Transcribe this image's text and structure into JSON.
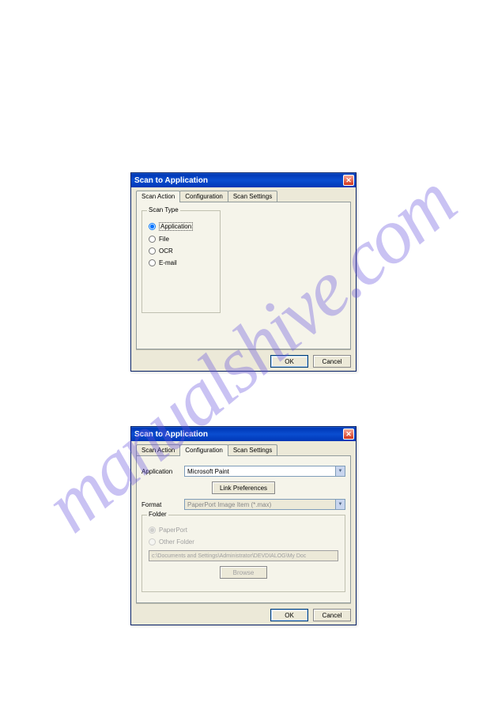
{
  "watermark": "manualshive.com",
  "dialog1": {
    "title": "Scan to Application",
    "tabs": {
      "scan_action": "Scan Action",
      "configuration": "Configuration",
      "scan_settings": "Scan Settings"
    },
    "group": {
      "legend": "Scan Type",
      "options": {
        "application": "Application",
        "file": "File",
        "ocr": "OCR",
        "email": "E-mail"
      }
    },
    "buttons": {
      "ok": "OK",
      "cancel": "Cancel"
    }
  },
  "dialog2": {
    "title": "Scan to Application",
    "tabs": {
      "scan_action": "Scan Action",
      "configuration": "Configuration",
      "scan_settings": "Scan Settings"
    },
    "labels": {
      "application": "Application",
      "format": "Format"
    },
    "app_value": "Microsoft Paint",
    "link_prefs": "Link Preferences",
    "format_value": "PaperPort Image Item (*.max)",
    "folder": {
      "legend": "Folder",
      "paperport": "PaperPort",
      "other": "Other Folder",
      "path": "c:\\Documents and Settings\\Administrator\\DEVDIALOG\\My Doc",
      "browse": "Browse"
    },
    "buttons": {
      "ok": "OK",
      "cancel": "Cancel"
    }
  }
}
